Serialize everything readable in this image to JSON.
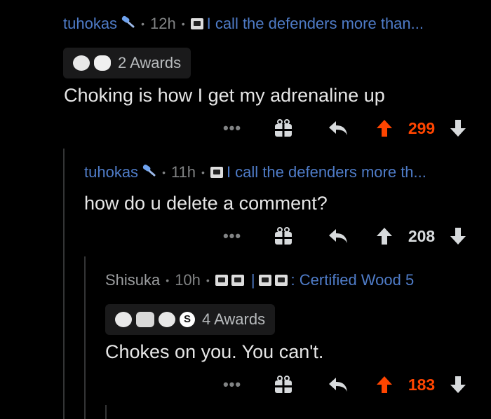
{
  "comments": [
    {
      "username": "tuhokas",
      "time": "12h",
      "flair": "I call the defenders more than...",
      "awards_label": "2 Awards",
      "body": "Choking is how I get my adrenaline up",
      "score": "299",
      "upvoted": true
    },
    {
      "username": "tuhokas",
      "time": "11h",
      "flair": "I call the defenders more th...",
      "body": "how do u delete a comment?",
      "score": "208",
      "upvoted": false
    },
    {
      "username": "Shisuka",
      "time": "10h",
      "flair_separator": "|",
      "flair": ": Certified Wood 5",
      "awards_label": "4 Awards",
      "body": "Chokes on you. You can't.",
      "score": "183",
      "upvoted": true
    }
  ],
  "icons": {
    "more": "more-options-icon",
    "gift": "award-gift-icon",
    "reply": "reply-icon",
    "upvote": "upvote-arrow-icon",
    "downvote": "downvote-arrow-icon"
  },
  "colors": {
    "background": "#000000",
    "username": "#4f7cc8",
    "upvote": "#ff4500",
    "muted": "#818384"
  },
  "more_label": "•••"
}
